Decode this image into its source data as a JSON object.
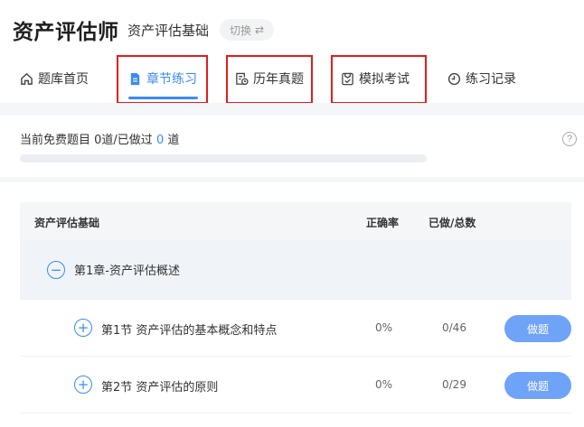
{
  "header": {
    "app_title": "资产评估师",
    "subject": "资产评估基础",
    "switch_label": "切换"
  },
  "nav": {
    "items": [
      {
        "label": "题库首页",
        "icon": "home-icon",
        "active": false
      },
      {
        "label": "章节练习",
        "icon": "document-icon",
        "active": true
      },
      {
        "label": "历年真题",
        "icon": "history-paper-icon",
        "active": false
      },
      {
        "label": "模拟考试",
        "icon": "exam-icon",
        "active": false
      },
      {
        "label": "练习记录",
        "icon": "record-clock-icon",
        "active": false
      }
    ]
  },
  "progress": {
    "prefix": "当前免费题目 ",
    "free_count": "0",
    "mid": "道/已做过 ",
    "done_count": "0",
    "suffix": " 道",
    "fraction": 0,
    "help": "?"
  },
  "table": {
    "headers": {
      "name": "资产评估基础",
      "accuracy": "正确率",
      "done_total": "已做/总数"
    },
    "chapter": {
      "title": "第1章-资产评估概述",
      "expanded": true
    },
    "sections": [
      {
        "title": "第1节 资产评估的基本概念和特点",
        "accuracy": "0%",
        "done_total": "0/46",
        "button": "做题"
      },
      {
        "title": "第2节 资产评估的原则",
        "accuracy": "0%",
        "done_total": "0/29",
        "button": "做题"
      }
    ]
  },
  "colors": {
    "accent": "#3a8cf4",
    "highlight_box": "#e51c1c",
    "button": "#6fa3f7"
  }
}
